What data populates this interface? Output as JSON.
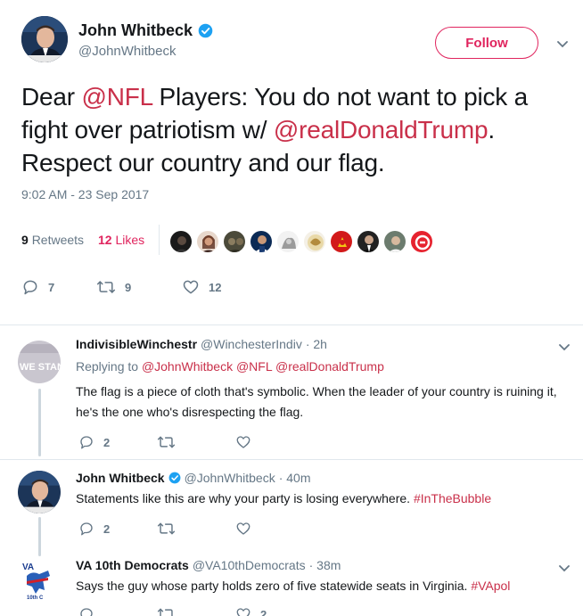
{
  "tweet": {
    "author_name": "John Whitbeck",
    "author_handle": "@JohnWhitbeck",
    "follow_label": "Follow",
    "text_parts": {
      "p1": "Dear ",
      "m1": "@NFL",
      "p2": " Players: You do not want to pick a fight over patriotism w/ ",
      "m2": "@realDonaldTrump",
      "p3": ". Respect our country and our flag."
    },
    "timestamp": "9:02 AM - 23 Sep 2017",
    "retweets_count": "9",
    "retweets_label": "Retweets",
    "likes_count": "12",
    "likes_label": "Likes",
    "actions": {
      "replies": "7",
      "retweets": "9",
      "likes": "12"
    }
  },
  "replies": [
    {
      "name": "IndivisibleWinchestr",
      "handle": "@WinchesterIndiv",
      "time": "· 2h",
      "replying_prefix": "Replying to",
      "replying_to": "@JohnWhitbeck @NFL @realDonaldTrump",
      "text": "The flag is a piece of cloth that's symbolic. When the leader of your country is ruining it, he's the one who's disrespecting the flag.",
      "replies": "2",
      "retweets": "",
      "likes": ""
    },
    {
      "name": "John Whitbeck",
      "handle": "@JohnWhitbeck",
      "time": "· 40m",
      "text_prefix": "Statements like this are why your party is losing everywhere. ",
      "hashtag": "#InTheBubble",
      "replies": "2",
      "retweets": "",
      "likes": ""
    },
    {
      "name": "VA 10th Democrats",
      "handle": "@VA10thDemocrats",
      "time": "· 38m",
      "text_prefix": "Says the guy whose party holds zero of five statewide seats in Virginia. ",
      "hashtag": "#VApol",
      "replies": "",
      "retweets": "",
      "likes": "2"
    }
  ],
  "avatar_labels": {
    "indivisible": "WE STAND",
    "va10": "VA",
    "va10_sub": "10th C"
  },
  "colors": {
    "accent": "#e0245e",
    "link": "#c9304a",
    "muted": "#657786",
    "verified": "#1da1f2"
  }
}
